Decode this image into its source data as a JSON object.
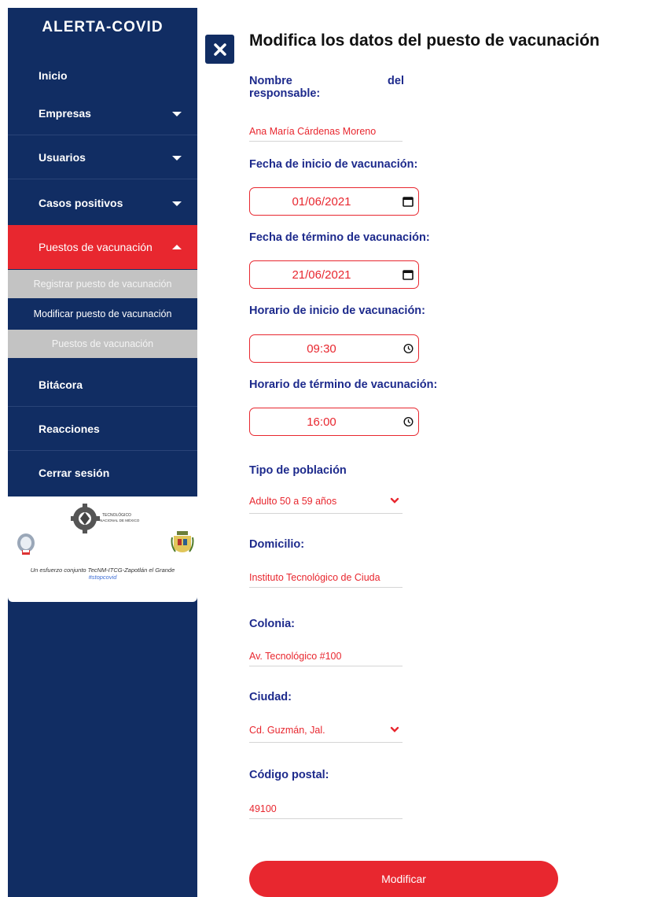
{
  "sidebar": {
    "brand": "ALERTA-COVID",
    "items": [
      {
        "label": "Inicio"
      },
      {
        "label": "Empresas"
      },
      {
        "label": "Usuarios"
      },
      {
        "label": "Casos positivos"
      },
      {
        "label": "Puestos de vacunación"
      },
      {
        "label": "Bitácora"
      },
      {
        "label": "Reacciones"
      },
      {
        "label": "Cerrar sesión"
      }
    ],
    "subitems": [
      {
        "label": "Registrar puesto de vacunación"
      },
      {
        "label": "Modificar puesto de vacunación"
      },
      {
        "label": "Puestos de vacunación"
      }
    ],
    "logo": {
      "org_name_line1": "TECNOLÓGICO",
      "org_name_line2": "NACIONAL DE MÉXICO",
      "caption": "Un esfuerzo conjunto TecNM-ITCG-Zapotlán el Grande",
      "hashtag": "#stopcovid"
    }
  },
  "form": {
    "title": "Modifica los datos del puesto de vacunación",
    "responsable": {
      "label_word1": "Nombre",
      "label_word2": "del",
      "label_word3": "responsable:",
      "value": "Ana María Cárdenas Moreno"
    },
    "fecha_inicio": {
      "label": "Fecha de inicio de vacunación:",
      "value": "01/06/2021"
    },
    "fecha_termino": {
      "label": "Fecha de término de vacunación:",
      "value": "21/06/2021"
    },
    "horario_inicio": {
      "label": "Horario de inicio de vacunación:",
      "value": "09:30"
    },
    "horario_termino": {
      "label": "Horario de término de vacunación:",
      "value": "16:00"
    },
    "tipo_poblacion": {
      "label": "Tipo de población",
      "value": "Adulto 50 a 59 años"
    },
    "domicilio": {
      "label": "Domicilio:",
      "value": "Instituto Tecnológico de Ciuda"
    },
    "colonia": {
      "label": "Colonia:",
      "value": "Av. Tecnológico #100"
    },
    "ciudad": {
      "label": "Ciudad:",
      "value": "Cd. Guzmán, Jal."
    },
    "codigo_postal": {
      "label": "Código postal:",
      "value": "49100"
    },
    "submit_label": "Modificar"
  },
  "colors": {
    "sidebar_bg": "#112d63",
    "accent_red": "#e8272f",
    "label_blue": "#1d2a8c",
    "submenu_grey": "#c3c3c3"
  },
  "icons": {
    "close": "close-icon",
    "calendar": "calendar-icon",
    "clock": "clock-icon",
    "chevron": "chevron-down-icon"
  }
}
